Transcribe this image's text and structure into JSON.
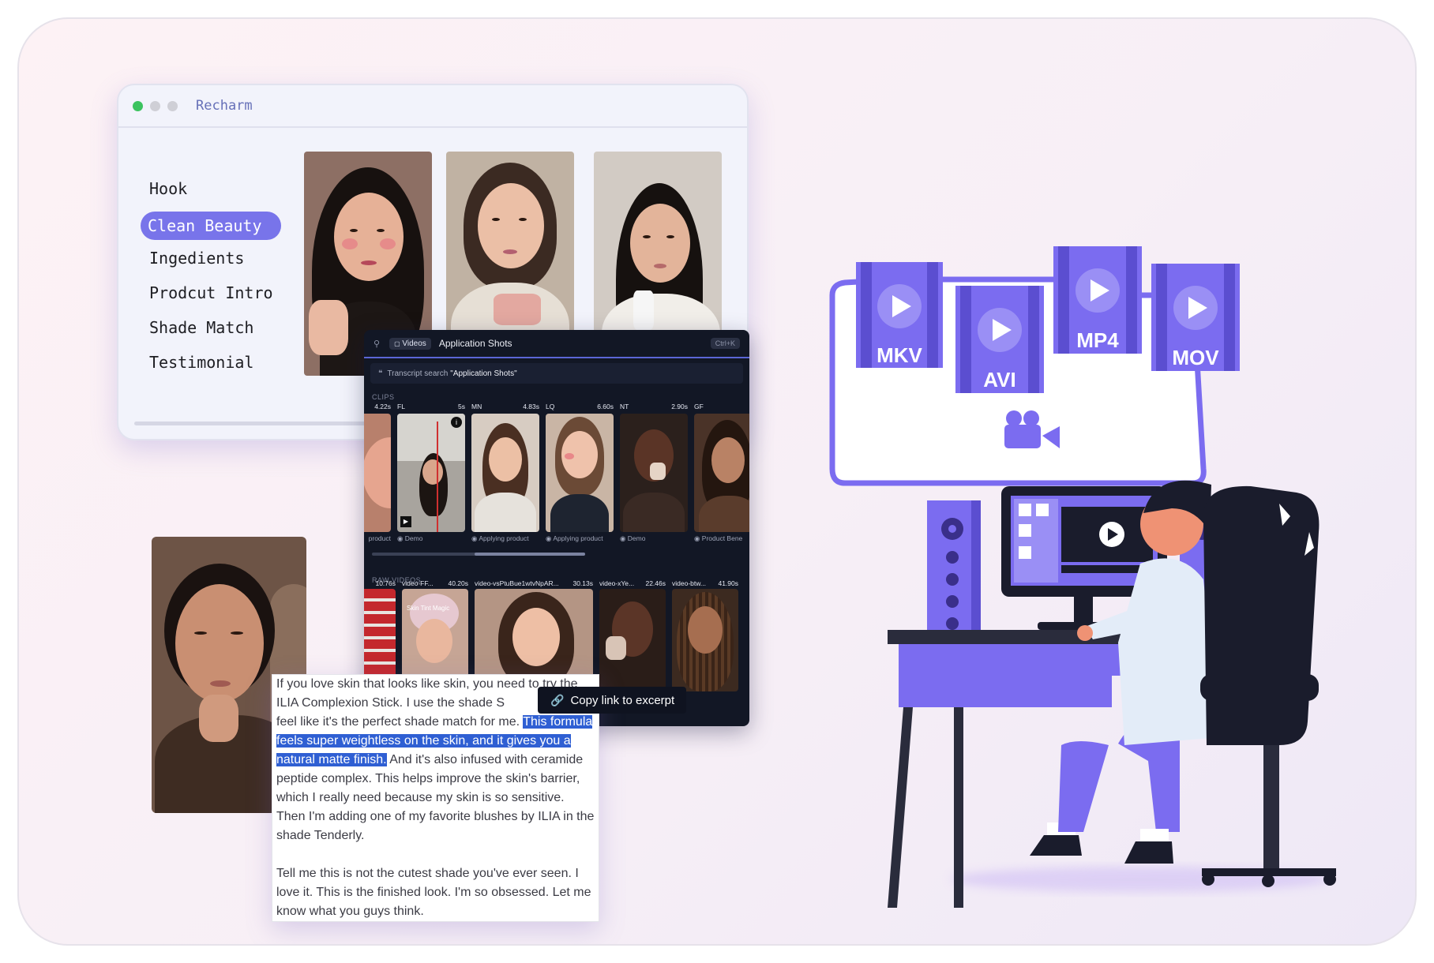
{
  "recharm": {
    "title": "Recharm",
    "dots": [
      "#3cc35f",
      "#cfcfd6",
      "#cfcfd6"
    ],
    "nav": [
      "Hook",
      "Clean Beauty",
      "Ingedients",
      "Prodcut Intro",
      "Shade Match",
      "Testimonial"
    ],
    "active_index": 1
  },
  "videos_panel": {
    "tab_label": "Videos",
    "query_title": "Application Shots",
    "shortcut": "Ctrl+K",
    "search_label": "Transcript search",
    "search_query": "\"Application Shots\"",
    "clips_header": "CLIPS",
    "clips": [
      {
        "code": "",
        "duration": "4.22s",
        "tag": "product"
      },
      {
        "code": "FL",
        "duration": "5s",
        "tag": "Demo"
      },
      {
        "code": "MN",
        "duration": "4.83s",
        "tag": "Applying product"
      },
      {
        "code": "LQ",
        "duration": "6.60s",
        "tag": "Applying product"
      },
      {
        "code": "NT",
        "duration": "2.90s",
        "tag": "Demo"
      },
      {
        "code": "GF",
        "duration": "",
        "tag": "Product Bene"
      }
    ],
    "raw_header": "RAW VIDEOS",
    "raw_videos": [
      {
        "name": "",
        "duration": "10.76s"
      },
      {
        "name": "video-FF...",
        "duration": "40.20s"
      },
      {
        "name": "video-vsPtuBue1wtvNpAR...",
        "duration": "30.13s"
      },
      {
        "name": "video-xYe...",
        "duration": "22.46s"
      },
      {
        "name": "video-btw...",
        "duration": "41.90s"
      }
    ],
    "raw_overlay_text": "Skin Tint Magic"
  },
  "tooltip": {
    "label": "Copy link to excerpt",
    "icon": "link-icon"
  },
  "transcript": {
    "before": "If you love skin that looks like skin, you need to try the ILIA Complexion Stick. I use the shade S",
    "before2": "feel like it's the perfect shade match for me. ",
    "highlight": "This formula feels super weightless on the skin, and it gives you a natural matte finish.",
    "after": " And it's also infused with ceramide peptide complex. This helps improve the skin's barrier, which I really need because my skin is so sensitive. Then I'm adding one of my favorite blushes by ILIA in the shade Tenderly.",
    "paragraph2": "Tell me this is not the cutest shade you've ever seen. I love it. This is the finished look. I'm so obsessed. Let me know what you guys think."
  },
  "formats": [
    "MKV",
    "AVI",
    "MP4",
    "MOV"
  ],
  "colors": {
    "accent": "#7874ea",
    "purple": "#7b6cf0",
    "highlight": "#2f5fd3",
    "dark_panel": "#121725"
  }
}
